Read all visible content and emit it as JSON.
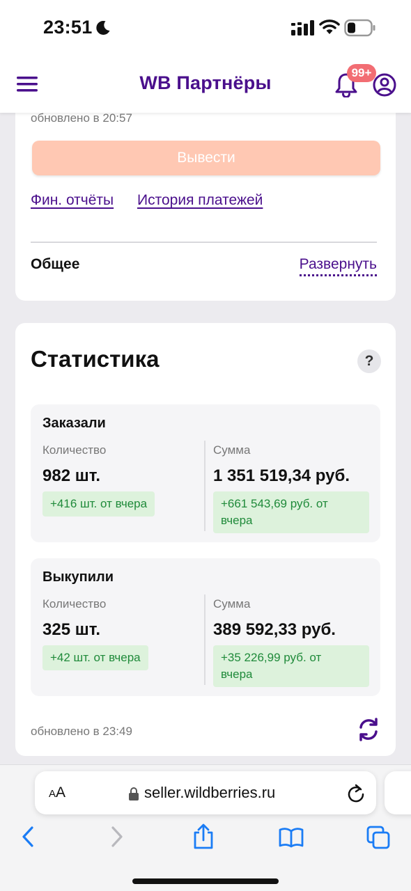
{
  "status_bar": {
    "time": "23:51"
  },
  "header": {
    "title": "WB Партнёры",
    "notifications_badge": "99+"
  },
  "balance_card": {
    "updated_text": "обновлено в 20:57",
    "withdraw_label": "Вывести",
    "links": [
      "Фин. отчёты",
      "История платежей"
    ],
    "general_label": "Общее",
    "expand_label": "Развернуть"
  },
  "statistics": {
    "title": "Статистика",
    "help_label": "?",
    "ordered": {
      "title": "Заказали",
      "quantity_label": "Количество",
      "quantity_value": "982 шт.",
      "quantity_delta": "+416 шт. от вчера",
      "sum_label": "Сумма",
      "sum_value": "1 351 519,34 руб.",
      "sum_delta_line1": "+661 543,69 руб. от",
      "sum_delta_line2": "вчера"
    },
    "bought": {
      "title": "Выкупили",
      "quantity_label": "Количество",
      "quantity_value": "325 шт.",
      "quantity_delta": "+42 шт. от вчера",
      "sum_label": "Сумма",
      "sum_value": "389 592,33 руб.",
      "sum_delta_line1": "+35 226,99 руб. от",
      "sum_delta_line2": "вчера"
    },
    "updated_text": "обновлено в 23:49"
  },
  "browser": {
    "text_size_small": "A",
    "text_size_large": "A",
    "url": "seller.wildberries.ru"
  },
  "colors": {
    "brand_purple": "#4a0f8c",
    "withdraw_disabled": "#ffc8b3",
    "badge_red": "#f26d73",
    "delta_green_text": "#1f8a3a",
    "delta_green_bg": "#ddf2dc",
    "ios_blue": "#1a7cf5"
  },
  "icons": [
    "moon-icon",
    "signal-icon",
    "wifi-icon",
    "battery-icon",
    "menu-icon",
    "bell-icon",
    "profile-icon",
    "question-icon",
    "refresh-icon",
    "lock-icon",
    "reload-icon",
    "back-icon",
    "forward-icon",
    "share-icon",
    "bookmarks-icon",
    "tabs-icon"
  ]
}
